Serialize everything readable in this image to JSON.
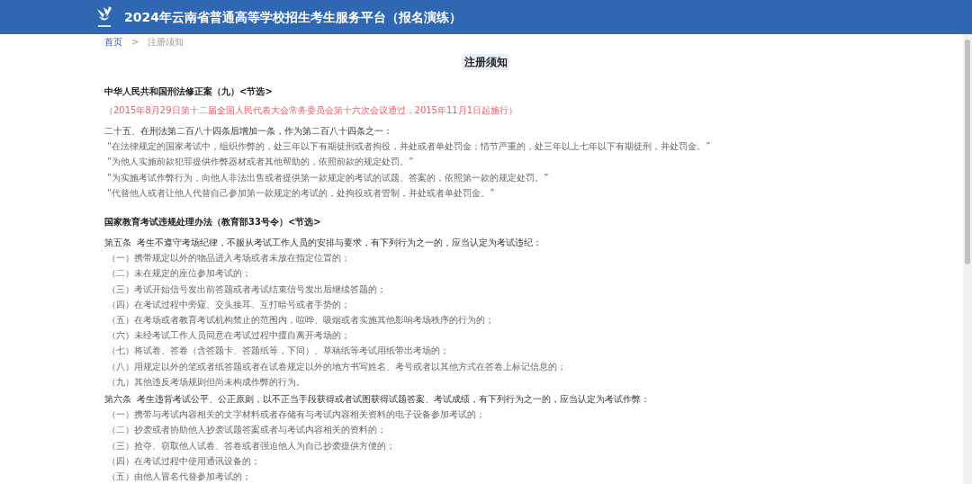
{
  "header": {
    "title": "2024年云南省普通高等学校招生考生服务平台（报名演练）"
  },
  "breadcrumb": [
    {
      "label": "首页",
      "link": true
    },
    {
      "label": ">",
      "link": false
    },
    {
      "label": "注册须知",
      "link": false
    }
  ],
  "page_title": "注册须知",
  "sections": [
    {
      "heading": "中华人民共和国刑法修正案（九）<节选>",
      "note": "（2015年8月29日第十二届全国人民代表大会常务委员会第十六次会议通过，2015年11月1日起施行）",
      "lines": [
        {
          "kind": "lead",
          "text": "二十五、在刑法第二百八十四条后增加一条，作为第二百八十四条之一："
        },
        {
          "kind": "item",
          "text": "“在法律规定的国家考试中，组织作弊的，处三年以下有期徒刑或者拘役，并处或者单处罚金；情节严重的，处三年以上七年以下有期徒刑，并处罚金。”"
        },
        {
          "kind": "item",
          "text": "“为他人实施前款犯罪提供作弊器材或者其他帮助的，依照前款的规定处罚。”"
        },
        {
          "kind": "item",
          "text": "“为实施考试作弊行为，向他人非法出售或者提供第一款规定的考试的试题、答案的，依照第一款的规定处罚。”"
        },
        {
          "kind": "item",
          "text": "“代替他人或者让他人代替自己参加第一款规定的考试的，处拘役或者管制，并处或者单处罚金。”"
        }
      ]
    },
    {
      "heading": "国家教育考试违规处理办法（教育部33号令）<节选>",
      "lines": [
        {
          "kind": "lead",
          "text": "第五条  考生不遵守考场纪律，不服从考试工作人员的安排与要求，有下列行为之一的，应当认定为考试违纪："
        },
        {
          "kind": "item",
          "text": "（一）携带规定以外的物品进入考场或者未放在指定位置的；"
        },
        {
          "kind": "item",
          "text": "（二）未在规定的座位参加考试的；"
        },
        {
          "kind": "item",
          "text": "（三）考试开始信号发出前答题或者考试结束信号发出后继续答题的；"
        },
        {
          "kind": "item",
          "text": "（四）在考试过程中旁窥、交头接耳、互打暗号或者手势的；"
        },
        {
          "kind": "item",
          "text": "（五）在考场或者教育考试机构禁止的范围内，喧哗、吸烟或者实施其他影响考场秩序的行为的；"
        },
        {
          "kind": "item",
          "text": "（六）未经考试工作人员同意在考试过程中擅自离开考场的；"
        },
        {
          "kind": "item",
          "text": "（七）将试卷、答卷（含答题卡、答题纸等，下同）、草稿纸等考试用纸带出考场的；"
        },
        {
          "kind": "item",
          "text": "（八）用规定以外的笔或者纸答题或者在试卷规定以外的地方书写姓名、考号或者以其他方式在答卷上标记信息的；"
        },
        {
          "kind": "item",
          "text": "（九）其他违反考场规则但尚未构成作弊的行为。"
        },
        {
          "kind": "lead",
          "text": "第六条  考生违背考试公平、公正原则，以不正当手段获得或者试图获得试题答案、考试成绩，有下列行为之一的，应当认定为考试作弊："
        },
        {
          "kind": "item",
          "text": "（一）携带与考试内容相关的文字材料或者存储有与考试内容相关资料的电子设备参加考试的；"
        },
        {
          "kind": "item",
          "text": "（二）抄袭或者协助他人抄袭试题答案或者与考试内容相关的资料的；"
        },
        {
          "kind": "item",
          "text": "（三）抢夺、窃取他人试卷、答卷或者强迫他人为自己抄袭提供方便的；"
        },
        {
          "kind": "item",
          "text": "（四）在考试过程中使用通讯设备的；"
        },
        {
          "kind": "item",
          "text": "（五）由他人冒名代替参加考试的；"
        }
      ]
    }
  ]
}
